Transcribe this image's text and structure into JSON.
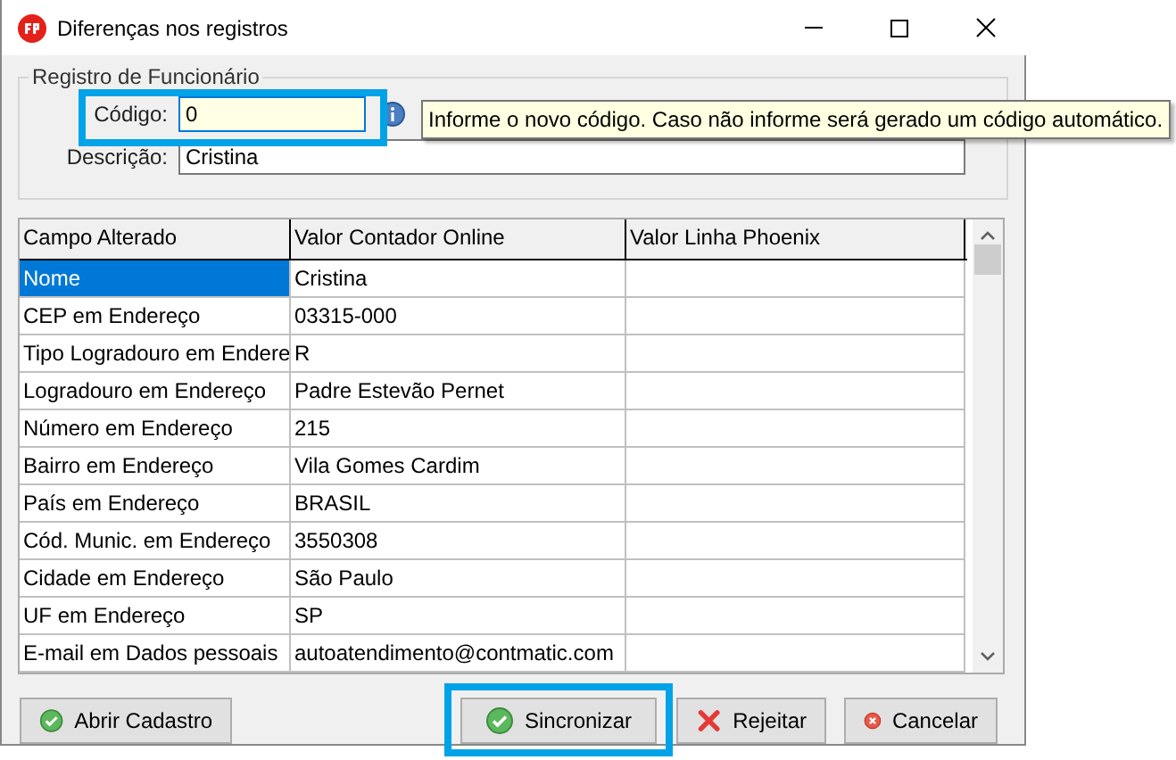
{
  "window": {
    "title": "Diferenças nos registros"
  },
  "group": {
    "title": "Registro de Funcionário",
    "fields": [
      {
        "label": "Código:",
        "value": "0",
        "focused": true,
        "highlighted": true
      },
      {
        "label": "Descrição:",
        "value": "Cristina",
        "focused": false,
        "highlighted": false
      }
    ],
    "tooltip": "Informe o novo código. Caso não informe será gerado um código automático."
  },
  "table": {
    "columns": [
      "Campo Alterado",
      "Valor Contador Online",
      "Valor Linha Phoenix"
    ],
    "rows": [
      {
        "cells": [
          "Nome",
          "Cristina",
          ""
        ],
        "selected": true
      },
      {
        "cells": [
          "CEP em Endereço",
          "03315-000",
          ""
        ],
        "selected": false
      },
      {
        "cells": [
          "Tipo Logradouro em Endere",
          "R",
          ""
        ],
        "selected": false
      },
      {
        "cells": [
          "Logradouro em Endereço",
          "Padre Estevão Pernet",
          ""
        ],
        "selected": false
      },
      {
        "cells": [
          "Número em Endereço",
          "215",
          ""
        ],
        "selected": false
      },
      {
        "cells": [
          "Bairro em Endereço",
          "Vila Gomes Cardim",
          ""
        ],
        "selected": false
      },
      {
        "cells": [
          "País em Endereço",
          "BRASIL",
          ""
        ],
        "selected": false
      },
      {
        "cells": [
          "Cód. Munic. em Endereço",
          "3550308",
          ""
        ],
        "selected": false
      },
      {
        "cells": [
          "Cidade em Endereço",
          "São Paulo",
          ""
        ],
        "selected": false
      },
      {
        "cells": [
          "UF em Endereço",
          "SP",
          ""
        ],
        "selected": false
      },
      {
        "cells": [
          "E-mail em Dados pessoais",
          "autoatendimento@contmatic.com",
          ""
        ],
        "selected": false
      }
    ]
  },
  "buttons": [
    {
      "label": "Abrir Cadastro",
      "kind": "check",
      "highlighted": false
    },
    {
      "label": "Sincronizar",
      "kind": "check",
      "highlighted": true
    },
    {
      "label": "Rejeitar",
      "kind": "cross",
      "highlighted": false
    },
    {
      "label": "Cancelar",
      "kind": "cancel",
      "highlighted": false
    }
  ]
}
